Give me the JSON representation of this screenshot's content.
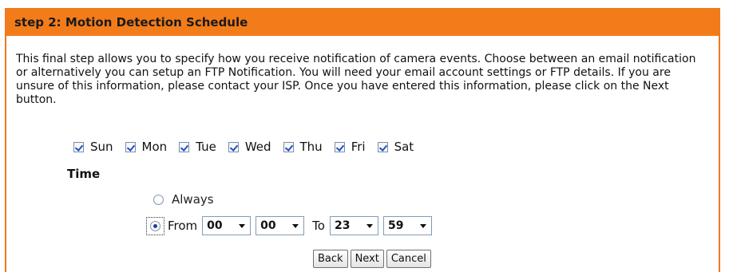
{
  "header": {
    "title": "step 2: Motion Detection Schedule"
  },
  "description": "This final step allows you to specify how you receive notification of camera events. Choose between an email notification or alternatively you can setup an FTP Notification. You will need your email account settings or FTP details. If you are unsure of this information, please contact your ISP. Once you have entered this information, please click on the Next button.",
  "days": [
    {
      "label": "Sun",
      "checked": true
    },
    {
      "label": "Mon",
      "checked": true
    },
    {
      "label": "Tue",
      "checked": true
    },
    {
      "label": "Wed",
      "checked": true
    },
    {
      "label": "Thu",
      "checked": true
    },
    {
      "label": "Fri",
      "checked": true
    },
    {
      "label": "Sat",
      "checked": true
    }
  ],
  "time": {
    "label": "Time",
    "always_label": "Always",
    "from_label": "From",
    "to_label": "To",
    "selected_option": "From",
    "from_hour": "00",
    "from_minute": "00",
    "to_hour": "23",
    "to_minute": "59"
  },
  "buttons": {
    "back": "Back",
    "next": "Next",
    "cancel": "Cancel"
  },
  "colors": {
    "header_background": "#f37c1a",
    "panel_border": "#f07a1e",
    "checkmark": "#1f4fbf"
  }
}
